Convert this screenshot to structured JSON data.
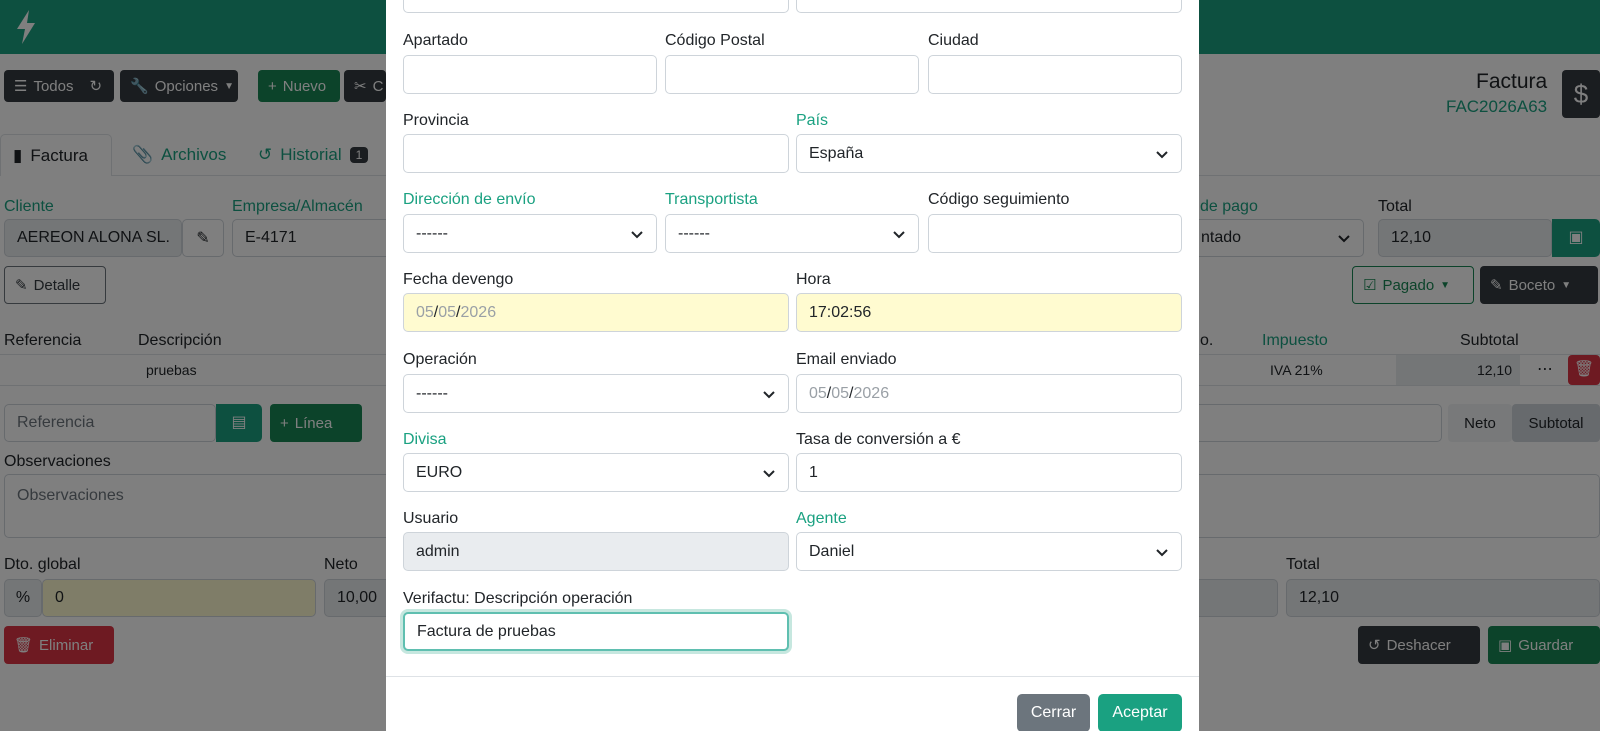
{
  "colors": {
    "brand": "#1aa181",
    "dark": "#343a40",
    "success": "#198754",
    "danger": "#dc3545"
  },
  "toolbar": {
    "todos": "Todos",
    "opciones": "Opciones",
    "nuevo": "Nuevo",
    "copy_partial": "C"
  },
  "document": {
    "type": "Factura",
    "code": "FAC2026A63"
  },
  "tabs": [
    {
      "label": "Factura",
      "icon": "file-icon"
    },
    {
      "label": "Archivos",
      "icon": "paperclip-icon"
    },
    {
      "label": "Historial",
      "icon": "history-icon",
      "badge": "1"
    }
  ],
  "header": {
    "cliente_label": "Cliente",
    "cliente_value": "AEREON ALONA SL.",
    "empresa_label": "Empresa/Almacén",
    "empresa_value": "E-4171",
    "pago_label_partial": "de pago",
    "pago_value_partial": "ntado",
    "total_label": "Total",
    "total_value": "12,10",
    "detalle": "Detalle",
    "pagado": "Pagado",
    "boceto": "Boceto"
  },
  "lines": {
    "col_referencia": "Referencia",
    "col_descripcion": "Descripción",
    "col_dto_partial": "o.",
    "col_impuesto": "Impuesto",
    "col_subtotal": "Subtotal",
    "row_desc": "pruebas",
    "row_tax": "IVA 21%",
    "row_subtotal": "12,10",
    "ref_placeholder": "Referencia",
    "linea": "Línea",
    "neto": "Neto",
    "subtotal_btn": "Subtotal"
  },
  "notes": {
    "label": "Observaciones",
    "placeholder": "Observaciones"
  },
  "totals": {
    "dto_label": "Dto. global",
    "dto_value": "0",
    "neto_label": "Neto",
    "neto_value": "10,00",
    "total_label": "Total",
    "total_value": "12,10"
  },
  "actions": {
    "eliminar": "Eliminar",
    "deshacer": "Deshacer",
    "guardar": "Guardar"
  },
  "modal": {
    "apartado_label": "Apartado",
    "cp_label": "Código Postal",
    "ciudad_label": "Ciudad",
    "provincia_label": "Provincia",
    "pais_label": "País",
    "pais_value": "España",
    "envio_label": "Dirección de envío",
    "envio_value": "------",
    "transportista_label": "Transportista",
    "transportista_value": "------",
    "seguimiento_label": "Código seguimiento",
    "fecha_label": "Fecha devengo",
    "fecha_day": "05",
    "fecha_month": "05",
    "fecha_year": "2026",
    "hora_label": "Hora",
    "hora_value": "17:02:56",
    "operacion_label": "Operación",
    "operacion_value": "------",
    "email_label": "Email enviado",
    "email_day": "05",
    "email_month": "05",
    "email_year": "2026",
    "divisa_label": "Divisa",
    "divisa_value": "EURO",
    "tasa_label": "Tasa de conversión a €",
    "tasa_value": "1",
    "usuario_label": "Usuario",
    "usuario_value": "admin",
    "agente_label": "Agente",
    "agente_value": "Daniel",
    "verifactu_label": "Verifactu: Descripción operación",
    "verifactu_value": "Factura de pruebas",
    "cerrar": "Cerrar",
    "aceptar": "Aceptar"
  }
}
